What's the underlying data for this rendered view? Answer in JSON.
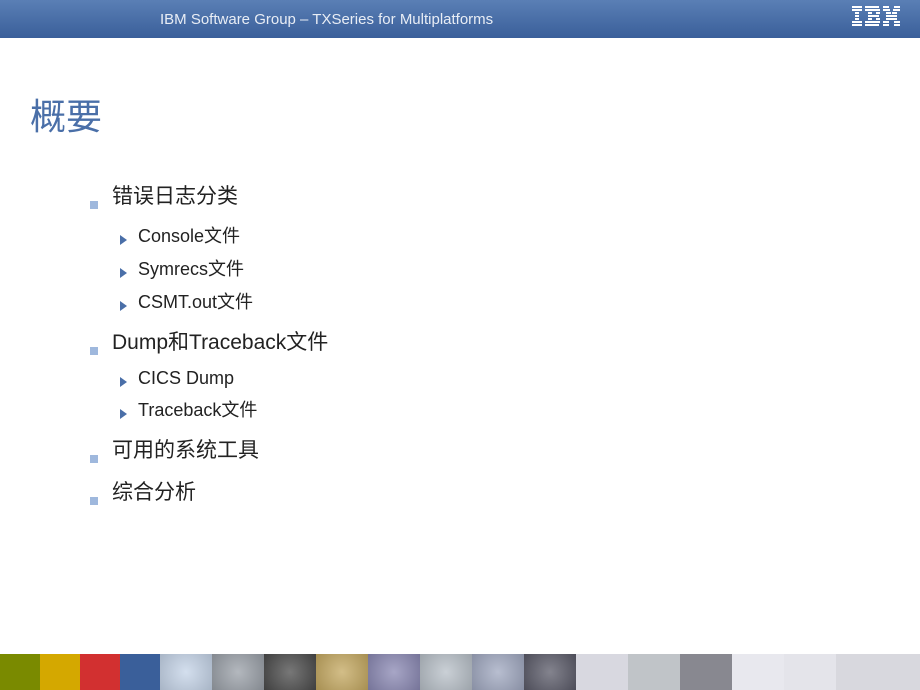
{
  "header": {
    "title": "IBM Software Group – TXSeries for Multiplatforms",
    "logo_text": "IBM"
  },
  "slide": {
    "title": "概要",
    "items": [
      {
        "label": "错误日志分类",
        "children": [
          {
            "label": "Console文件"
          },
          {
            "label": "Symrecs文件"
          },
          {
            "label": "CSMT.out文件"
          }
        ]
      },
      {
        "label": "Dump和Traceback文件",
        "children": [
          {
            "label": "CICS Dump"
          },
          {
            "label": "Traceback文件"
          }
        ]
      },
      {
        "label": "可用的系统工具",
        "children": []
      },
      {
        "label": "综合分析",
        "children": []
      }
    ]
  },
  "footer_colors": [
    "#7a8a00",
    "#d4a800",
    "#d23030",
    "#3a5f9a",
    "#c5d4e8",
    "#9aa0a8",
    "#4a4a4a",
    "#c4a860",
    "#8a88b3",
    "#b8c0c8",
    "#a0a8c0",
    "#5a5a68",
    "#d8d8e0",
    "#c0c4c8",
    "#888890",
    "#e8e8ee",
    "#e4e4ea",
    "#d8d8de"
  ]
}
